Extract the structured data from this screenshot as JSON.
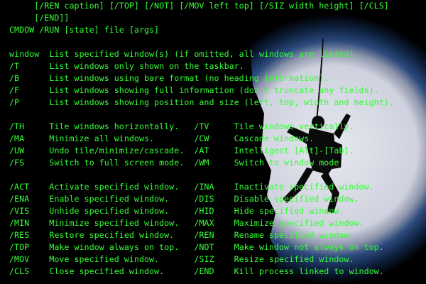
{
  "colors": {
    "text": "#33ff33",
    "background": "#000000",
    "wallpaper_glow": "#d9dbe6",
    "wallpaper_edge": "#1f3b6e"
  },
  "wallpaper": {
    "icon": "climber-silhouette-wallpaper"
  },
  "console": {
    "lines": [
      "     [/REN caption] [/TOP] [/NOT] [/MOV left top] [/SIZ width height] [/CLS]",
      "     [/END]]",
      "CMDOW /RUN [state] file [args]",
      "",
      "window  List specified window(s) (if omitted, all windows are listed).",
      "/T      List windows only shown on the taskbar.",
      "/B      List windows using bare format (no heading information).",
      "/F      List windows showing full information (don't truncate any fields).",
      "/P      List windows showing position and size (left, top, width and height).",
      "",
      "/TH     Tile windows horizontally.   /TV     Tile windows vertically.",
      "/MA     Minimize all windows.        /CW     Cascade windows.",
      "/UW     Undo tile/minimize/cascade.  /AT     Intelligent [Alt]-[Tab].",
      "/FS     Switch to full screen mode.  /WM     Switch to window mode.",
      "",
      "/ACT    Activate specified window.   /INA    Inactivate specified window.",
      "/ENA    Enable specified window.     /DIS    Disable specified window.",
      "/VIS    Unhide specified window.     /HID    Hide specified window.",
      "/MIN    Minimize specified window.   /MAX    Maximize specified window.",
      "/RES    Restore specified window.    /REN    Rename specified window.",
      "/TOP    Make window always on top.   /NOT    Make window not always on top.",
      "/MOV    Move specified window.       /SIZ    Resize specified window.",
      "/CLS    Close specified window.      /END    Kill process linked to window."
    ]
  }
}
